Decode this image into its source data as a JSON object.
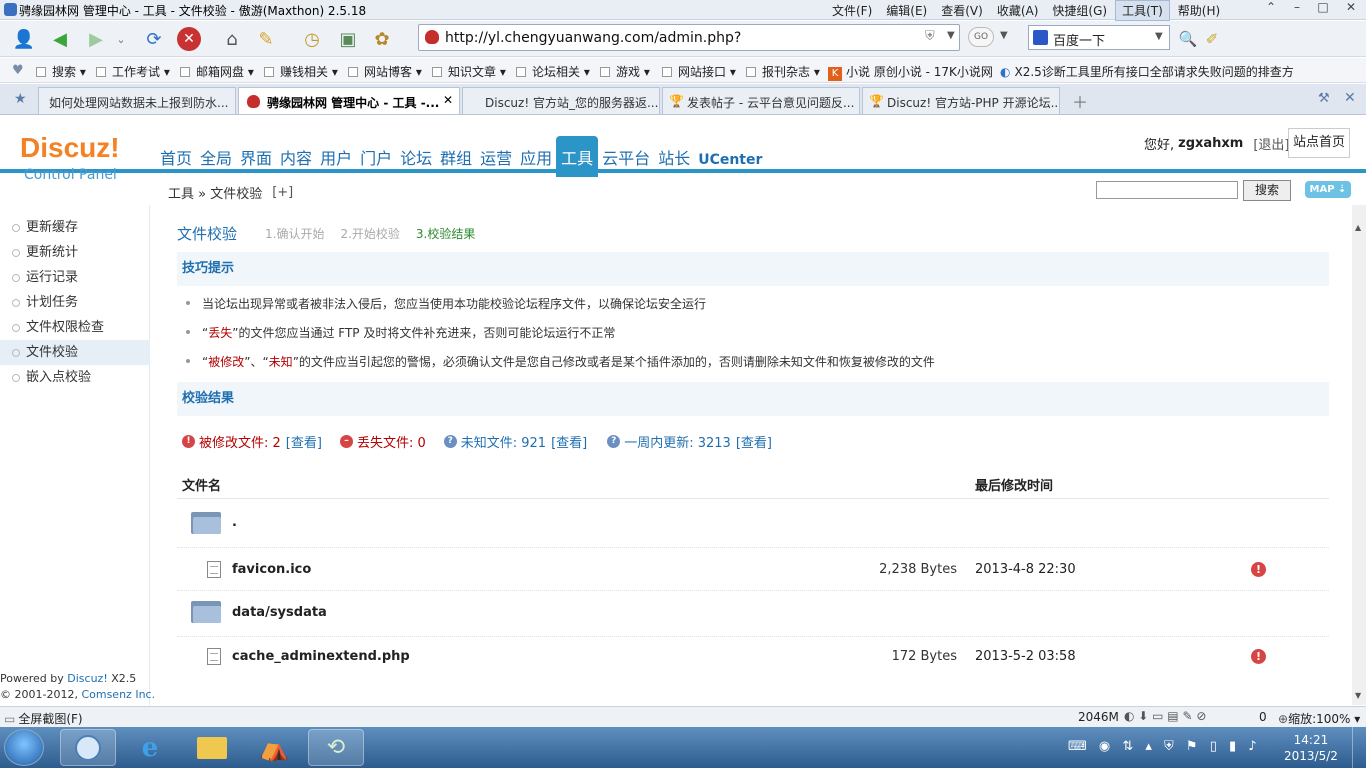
{
  "window": {
    "title": "骋缘园林网 管理中心 - 工具 - 文件校验 - 傲游(Maxthon) 2.5.18"
  },
  "menu": [
    "文件(F)",
    "编辑(E)",
    "查看(V)",
    "收藏(A)",
    "快捷组(G)",
    "工具(T)",
    "帮助(H)"
  ],
  "address": {
    "url": "http://yl.chengyuanwang.com/admin.php?",
    "search_value": "百度一下"
  },
  "favorites": [
    "搜索",
    "工作考试",
    "邮箱网盘",
    "赚钱相关",
    "网站博客",
    "知识文章",
    "论坛相关",
    "游戏",
    "网站接口",
    "报刊杂志",
    "小说 原创小说 - 17K小说网",
    "X2.5诊断工具里所有接口全部请求失败问题的排查方"
  ],
  "tabs": [
    {
      "label": "如何处理网站数据未上报到防水..."
    },
    {
      "label": "骋缘园林网 管理中心 - 工具 -..."
    },
    {
      "label": "Discuz! 官方站_您的服务器返..."
    },
    {
      "label": "发表帖子 - 云平台意见问题反..."
    },
    {
      "label": "Discuz! 官方站-PHP 开源论坛..."
    }
  ],
  "header": {
    "logo_main": "Discuz!",
    "logo_sub": "Control Panel",
    "nav": [
      "首页",
      "全局",
      "界面",
      "内容",
      "用户",
      "门户",
      "论坛",
      "群组",
      "运营",
      "应用",
      "工具",
      "云平台",
      "站长",
      "UCenter"
    ],
    "greeting": "您好,",
    "username": "zgxahxm",
    "logout": "[退出]",
    "site_home": "站点首页"
  },
  "crumb": {
    "text": "工具 » 文件校验",
    "add": "[+]",
    "search_btn": "搜索",
    "map_btn": "MAP ⇣"
  },
  "sidebar": {
    "items": [
      "更新缓存",
      "更新统计",
      "运行记录",
      "计划任务",
      "文件权限检查",
      "文件校验",
      "嵌入点校验"
    ]
  },
  "footer": {
    "powered_label": "Powered by ",
    "powered_brand": "Discuz!",
    "version": " X2.5",
    "copy_label": "© 2001-2012, ",
    "copy_brand": "Comsenz Inc."
  },
  "main": {
    "title": "文件校验",
    "steps": [
      "1.确认开始",
      "2.开始校验",
      "3.校验结果"
    ],
    "tips_title": "技巧提示",
    "tip1": "当论坛出现异常或者被非法入侵后，您应当使用本功能校验论坛程序文件，以确保论坛安全运行",
    "tip2": {
      "a": "“",
      "b": "丢失",
      "c": "”的文件您应当通过 FTP 及时将文件补充进来，否则可能论坛运行不正常"
    },
    "tip3": {
      "a": "“",
      "b": "被修改",
      "c": "”、“",
      "d": "未知",
      "e": "”的文件应当引起您的警惕，必须确认文件是您自己修改或者是某个插件添加的，否则请删除未知文件和恢复被修改的文件"
    },
    "result_title": "校验结果",
    "stats": {
      "modified": "被修改文件: 2",
      "lost": "丢失文件: 0",
      "unknown": "未知文件: 921",
      "recent": "一周内更新: 3213",
      "view": "[查看]"
    },
    "table_head": {
      "name": "文件名",
      "time": "最后修改时间"
    },
    "rows": [
      {
        "name": ".",
        "size": "",
        "time": ""
      },
      {
        "name": "favicon.ico",
        "size": "2,238 Bytes",
        "time": "2013-4-8 22:30"
      },
      {
        "name": "data/sysdata",
        "size": "",
        "time": ""
      },
      {
        "name": "cache_adminextend.php",
        "size": "172 Bytes",
        "time": "2013-5-2 03:58"
      }
    ]
  },
  "statusbar": {
    "left": "全屏截图(F)",
    "mem": "2046M",
    "counter": "0",
    "zoom": "缩放:100%"
  },
  "taskbar": {
    "time": "14:21",
    "date": "2013/5/2"
  }
}
